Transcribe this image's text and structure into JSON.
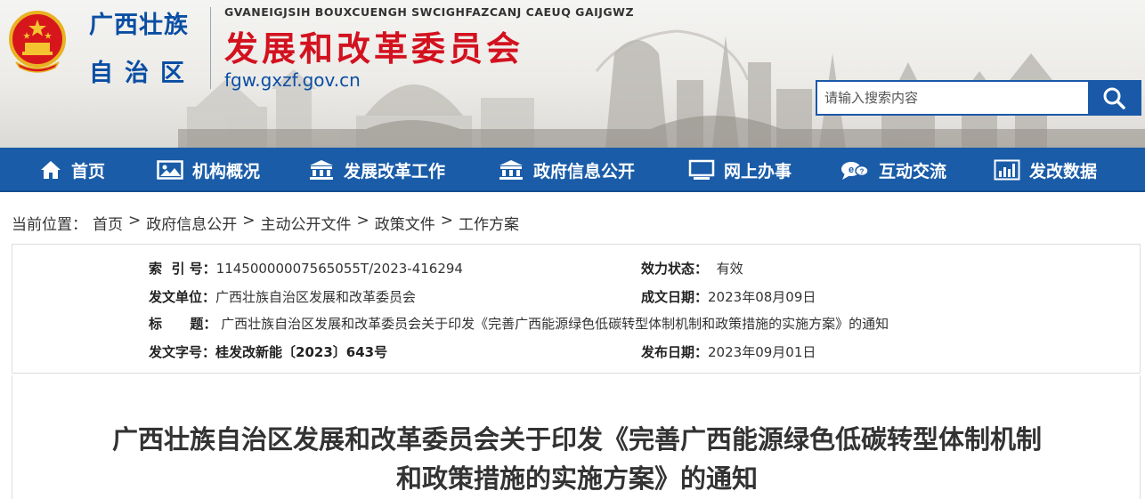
{
  "header": {
    "gov_line1": "广西壮族",
    "gov_line2": "自治区",
    "zhuang_text": "GVANEIGJSIH BOUXCUENGH SWCIGHFAZCANJ CAEUQ GAIJGWZ",
    "org_name": "发展和改革委员会",
    "domain": "fgw.gxzf.gov.cn",
    "search_placeholder": "请输入搜索内容"
  },
  "nav": {
    "items": [
      {
        "label": "首页",
        "icon": "home-icon"
      },
      {
        "label": "机构概况",
        "icon": "image-icon"
      },
      {
        "label": "发展改革工作",
        "icon": "building-icon"
      },
      {
        "label": "政府信息公开",
        "icon": "building-icon"
      },
      {
        "label": "网上办事",
        "icon": "monitor-icon"
      },
      {
        "label": "互动交流",
        "icon": "chat-icon"
      },
      {
        "label": "发改数据",
        "icon": "bar-chart-icon"
      }
    ]
  },
  "breadcrumb": {
    "label": "当前位置：",
    "items": [
      "首页",
      "政府信息公开",
      "主动公开文件",
      "政策文件",
      "工作方案"
    ],
    "separator": ">"
  },
  "info": {
    "index_label": "索  引 号：",
    "index_value": "11450000007565055T/2023-416294",
    "status_label": "效力状态：",
    "status_value": "有效",
    "issuer_label": "发文单位：",
    "issuer_value": "广西壮族自治区发展和改革委员会",
    "date_made_label": "成文日期：",
    "date_made_value": "2023年08月09日",
    "title_label": "标      题：",
    "title_value": "广西壮族自治区发展和改革委员会关于印发《完善广西能源绿色低碳转型体制机制和政策措施的实施方案》的通知",
    "doc_no_label": "发文字号：",
    "doc_no_value": "桂发改新能〔2023〕643号",
    "date_pub_label": "发布日期：",
    "date_pub_value": "2023年09月01日"
  },
  "article": {
    "title_line1": "广西壮族自治区发展和改革委员会关于印发《完善广西能源绿色低碳转型体制机制",
    "title_line2": "和政策措施的实施方案》的通知"
  },
  "colors": {
    "nav_bg": "#1a5ca8",
    "org_red": "#d3121f",
    "brand_blue": "#0a4ea3"
  }
}
